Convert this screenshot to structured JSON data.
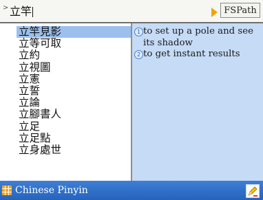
{
  "search": {
    "query": "立竿",
    "fs_button": "FSPath"
  },
  "results": {
    "items": [
      "立竿見影",
      "立等可取",
      "立約",
      "立視圖",
      "立憲",
      "立誓",
      "立論",
      "立腳書人",
      "立足",
      "立足點",
      "立身處世"
    ],
    "selected_index": 0
  },
  "definition": {
    "senses": [
      {
        "num": "1",
        "text": "to set up a pole and see its shadow"
      },
      {
        "num": "2",
        "text": "to get instant results"
      }
    ]
  },
  "status": {
    "input_method": "Chinese Pinyin"
  },
  "colors": {
    "accent": "#f0a400",
    "selection": "#9cc0ee",
    "definition_bg": "#c5dbf6",
    "status_bar": "#2c6cc6"
  },
  "icons": {
    "forward": "play-arrow-icon",
    "input_method": "grid-icon",
    "edit": "pencil-icon"
  }
}
